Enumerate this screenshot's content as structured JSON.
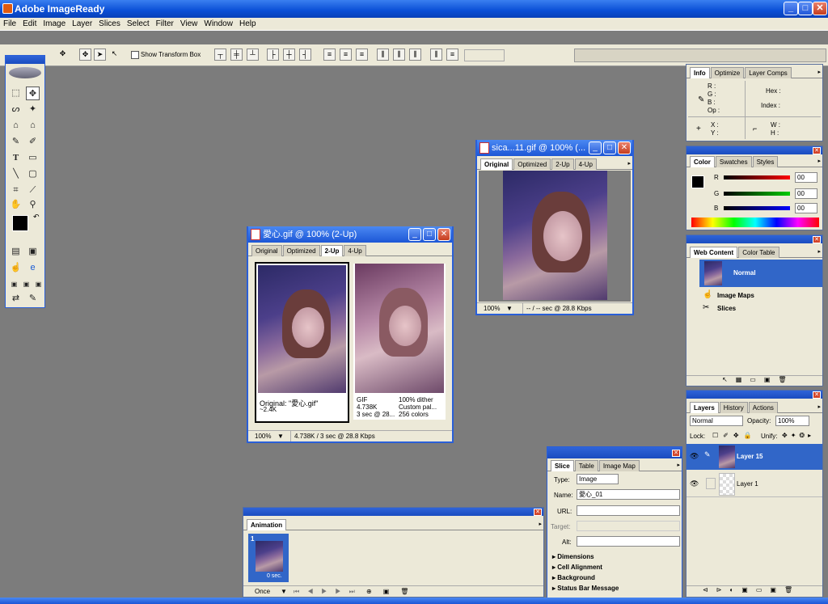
{
  "app": {
    "title": "Adobe ImageReady"
  },
  "menu": [
    "File",
    "Edit",
    "Image",
    "Layer",
    "Slices",
    "Select",
    "Filter",
    "View",
    "Window",
    "Help"
  ],
  "options": {
    "show_transform": "Show Transform Box"
  },
  "doc1": {
    "title": "愛心.gif @ 100% (2-Up)",
    "tabs": [
      "Original",
      "Optimized",
      "2-Up",
      "4-Up"
    ],
    "left_caption": "Original: \"愛心.gif\"",
    "left_size": "~2.4K",
    "right_col1": [
      "GIF",
      "4.738K",
      "3 sec @ 28..."
    ],
    "right_col2": [
      "100% dither",
      "Custom pal...",
      "256 colors"
    ],
    "zoom": "100%",
    "status": "4.738K / 3 sec @ 28.8 Kbps"
  },
  "doc2": {
    "title": "sica...11.gif @ 100% (...",
    "tabs": [
      "Original",
      "Optimized",
      "2-Up",
      "4-Up"
    ],
    "zoom": "100%",
    "status": "-- / -- sec @ 28.8 Kbps"
  },
  "info": {
    "tabs": [
      "Info",
      "Optimize",
      "Layer Comps"
    ],
    "rgb": "R :\nG :\nB :\nOp :",
    "hex": "Hex :",
    "index": "Index :",
    "xy": "X :\nY :",
    "wh": "W :\nH :"
  },
  "color": {
    "tabs": [
      "Color",
      "Swatches",
      "Styles"
    ],
    "r": "R",
    "g": "G",
    "b": "B",
    "rv": "00",
    "gv": "00",
    "bv": "00"
  },
  "web": {
    "tabs": [
      "Web Content",
      "Color Table"
    ],
    "normal": "Normal",
    "image_maps": "Image Maps",
    "slices": "Slices"
  },
  "layers": {
    "tabs": [
      "Layers",
      "History",
      "Actions"
    ],
    "blend": "Normal",
    "opacity_label": "Opacity:",
    "opacity": "100%",
    "lock": "Lock:",
    "unify": "Unify:",
    "items": [
      "Layer 15",
      "Layer 1"
    ]
  },
  "slice": {
    "tabs": [
      "Slice",
      "Table",
      "Image Map"
    ],
    "type_label": "Type:",
    "type": "Image",
    "name_label": "Name:",
    "name": "愛心_01",
    "url_label": "URL:",
    "target_label": "Target:",
    "alt_label": "Alt:",
    "sections": [
      "Dimensions",
      "Cell Alignment",
      "Background",
      "Status Bar Message"
    ]
  },
  "animation": {
    "tab": "Animation",
    "frame_num": "1",
    "frame_delay": "0 sec.",
    "loop": "Once"
  }
}
